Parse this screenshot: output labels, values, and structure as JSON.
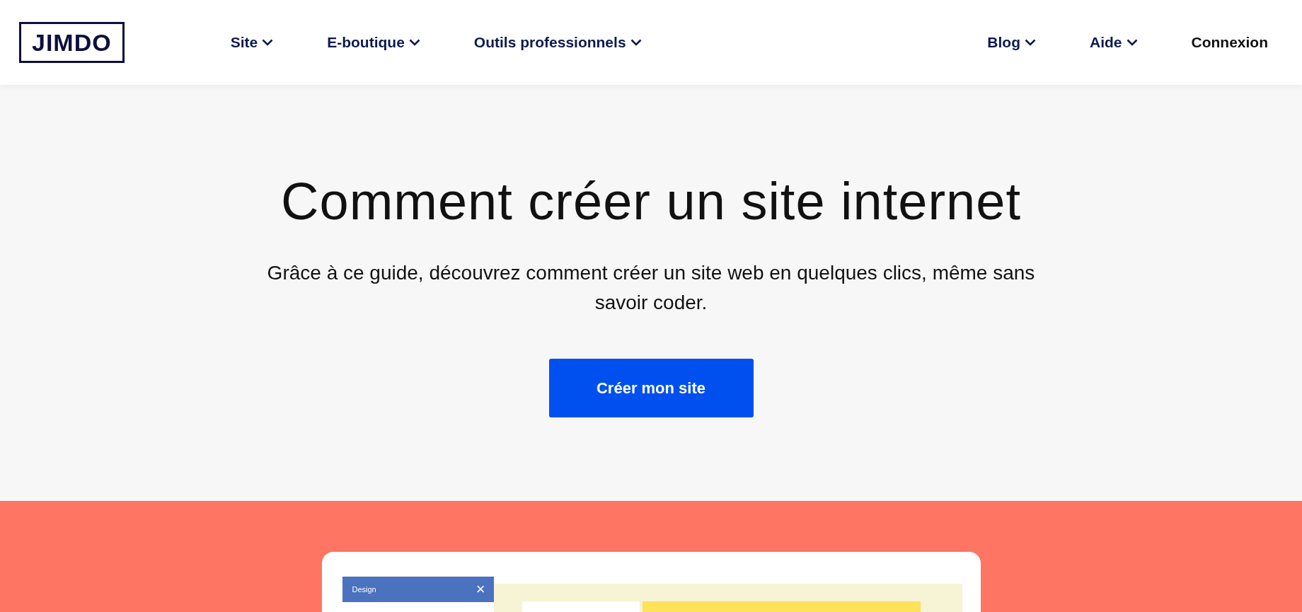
{
  "header": {
    "logo": "JIMDO",
    "nav": [
      {
        "label": "Site",
        "dropdown": true
      },
      {
        "label": "E-boutique",
        "dropdown": true
      },
      {
        "label": "Outils professionnels",
        "dropdown": true
      }
    ],
    "nav_right": [
      {
        "label": "Blog",
        "dropdown": true
      },
      {
        "label": "Aide",
        "dropdown": true
      },
      {
        "label": "Connexion",
        "dropdown": false
      }
    ]
  },
  "hero": {
    "title": "Comment créer un site internet",
    "subtitle": "Grâce à ce guide, découvrez comment créer un site web en quelques clics, même sans savoir coder.",
    "button": "Créer mon site"
  },
  "preview": {
    "panel_title": "Design",
    "panel_close": "×"
  }
}
